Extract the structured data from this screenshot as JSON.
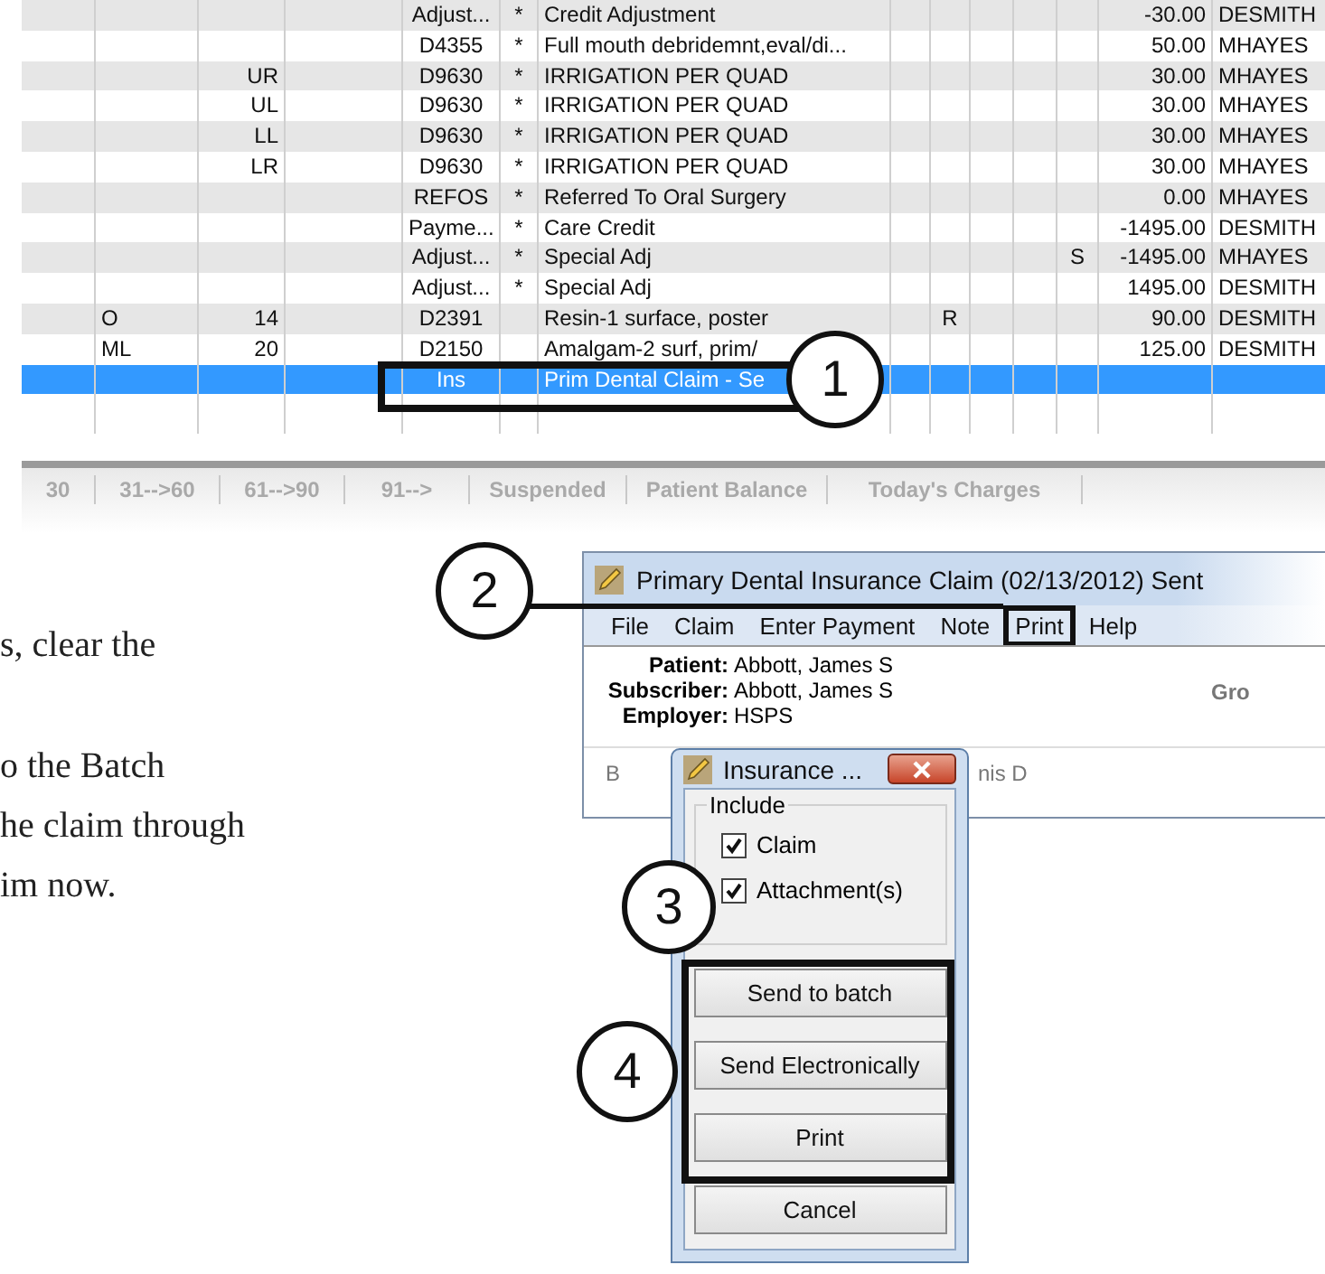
{
  "table": {
    "rows": [
      {
        "selected": false,
        "cells": {
          "column_5": "Adjust...",
          "column_6": "*",
          "column_7": "Credit Adjustment",
          "column_13": "-30.00",
          "column_14": "DESMITH"
        }
      },
      {
        "selected": false,
        "cells": {
          "column_5": "D4355",
          "column_6": "*",
          "column_7": "Full mouth debridemnt,eval/di...",
          "column_13": "50.00",
          "column_14": "MHAYES"
        }
      },
      {
        "selected": false,
        "cells": {
          "column_3": "UR",
          "column_5": "D9630",
          "column_6": "*",
          "column_7": "IRRIGATION PER QUAD",
          "column_13": "30.00",
          "column_14": "MHAYES"
        }
      },
      {
        "selected": false,
        "cells": {
          "column_3": "UL",
          "column_5": "D9630",
          "column_6": "*",
          "column_7": "IRRIGATION PER QUAD",
          "column_13": "30.00",
          "column_14": "MHAYES"
        }
      },
      {
        "selected": false,
        "cells": {
          "column_3": "LL",
          "column_5": "D9630",
          "column_6": "*",
          "column_7": "IRRIGATION PER QUAD",
          "column_13": "30.00",
          "column_14": "MHAYES"
        }
      },
      {
        "selected": false,
        "cells": {
          "column_3": "LR",
          "column_5": "D9630",
          "column_6": "*",
          "column_7": "IRRIGATION PER QUAD",
          "column_13": "30.00",
          "column_14": "MHAYES"
        }
      },
      {
        "selected": false,
        "cells": {
          "column_5": "REFOS",
          "column_6": "*",
          "column_7": "Referred To Oral Surgery",
          "column_13": "0.00",
          "column_14": "MHAYES"
        }
      },
      {
        "selected": false,
        "cells": {
          "column_5": "Payme...",
          "column_6": "*",
          "column_7": "Care Credit",
          "column_13": "-1495.00",
          "column_14": "DESMITH"
        }
      },
      {
        "selected": false,
        "cells": {
          "column_5": "Adjust...",
          "column_6": "*",
          "column_7": "Special Adj",
          "column_12": "S",
          "column_13": "-1495.00",
          "column_14": "MHAYES"
        }
      },
      {
        "selected": false,
        "cells": {
          "column_5": "Adjust...",
          "column_6": "*",
          "column_7": "Special Adj",
          "column_13": "1495.00",
          "column_14": "DESMITH"
        }
      },
      {
        "selected": false,
        "cells": {
          "column_2": "O",
          "column_3": "14",
          "column_5": "D2391",
          "column_7": "Resin-1 surface, poster",
          "column_9": "R",
          "column_13": "90.00",
          "column_14": "DESMITH"
        }
      },
      {
        "selected": false,
        "cells": {
          "column_2": "ML",
          "column_3": "20",
          "column_5": "D2150",
          "column_7": "Amalgam-2 surf, prim/",
          "column_13": "125.00",
          "column_14": "DESMITH"
        }
      },
      {
        "selected": true,
        "cells": {
          "column_5": "Ins",
          "column_7": "Prim Dental Claim - Se"
        }
      }
    ]
  },
  "summary_tabs": [
    "30",
    "31-->60",
    "61-->90",
    "91-->",
    "Suspended",
    "Patient Balance",
    "Today's Charges"
  ],
  "instructions": [
    [
      "s, clear the"
    ],
    [
      "o the Batch",
      "he claim through",
      "im now."
    ]
  ],
  "claim_window": {
    "title": "Primary Dental Insurance Claim (02/13/2012) Sent",
    "menu": [
      {
        "label": "File",
        "framed": false
      },
      {
        "label": "Claim",
        "framed": false
      },
      {
        "label": "Enter Payment",
        "framed": false
      },
      {
        "label": "Note",
        "framed": false
      },
      {
        "label": "Print",
        "framed": true
      },
      {
        "label": "Help",
        "framed": false
      }
    ],
    "fields": [
      {
        "label": "Patient:",
        "value": "Abbott, James S"
      },
      {
        "label": "Subscriber:",
        "value": "Abbott, James S"
      },
      {
        "label": "Employer:",
        "value": "HSPS"
      }
    ],
    "group_label": "Gro",
    "lower_label": "B",
    "lower_value": "nis D"
  },
  "dialog": {
    "title": "Insurance ...",
    "group": "Include",
    "checkboxes": [
      {
        "label": "Claim",
        "checked": true
      },
      {
        "label": "Attachment(s)",
        "checked": true
      }
    ],
    "buttons": [
      "Send to batch",
      "Send Electronically",
      "Print",
      "Cancel"
    ]
  },
  "callouts": [
    {
      "label": "1"
    },
    {
      "label": "2"
    },
    {
      "label": "3"
    },
    {
      "label": "4"
    }
  ]
}
